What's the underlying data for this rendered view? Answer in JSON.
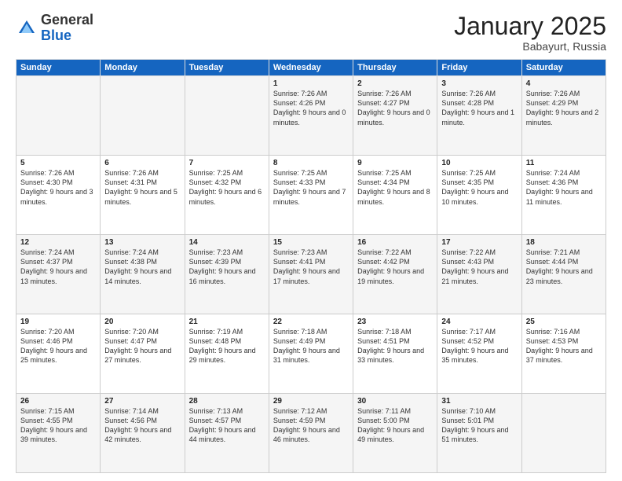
{
  "header": {
    "logo_general": "General",
    "logo_blue": "Blue",
    "title": "January 2025",
    "subtitle": "Babayurt, Russia"
  },
  "weekdays": [
    "Sunday",
    "Monday",
    "Tuesday",
    "Wednesday",
    "Thursday",
    "Friday",
    "Saturday"
  ],
  "weeks": [
    [
      {
        "day": "",
        "sunrise": "",
        "sunset": "",
        "daylight": ""
      },
      {
        "day": "",
        "sunrise": "",
        "sunset": "",
        "daylight": ""
      },
      {
        "day": "",
        "sunrise": "",
        "sunset": "",
        "daylight": ""
      },
      {
        "day": "1",
        "sunrise": "Sunrise: 7:26 AM",
        "sunset": "Sunset: 4:26 PM",
        "daylight": "Daylight: 9 hours and 0 minutes."
      },
      {
        "day": "2",
        "sunrise": "Sunrise: 7:26 AM",
        "sunset": "Sunset: 4:27 PM",
        "daylight": "Daylight: 9 hours and 0 minutes."
      },
      {
        "day": "3",
        "sunrise": "Sunrise: 7:26 AM",
        "sunset": "Sunset: 4:28 PM",
        "daylight": "Daylight: 9 hours and 1 minute."
      },
      {
        "day": "4",
        "sunrise": "Sunrise: 7:26 AM",
        "sunset": "Sunset: 4:29 PM",
        "daylight": "Daylight: 9 hours and 2 minutes."
      }
    ],
    [
      {
        "day": "5",
        "sunrise": "Sunrise: 7:26 AM",
        "sunset": "Sunset: 4:30 PM",
        "daylight": "Daylight: 9 hours and 3 minutes."
      },
      {
        "day": "6",
        "sunrise": "Sunrise: 7:26 AM",
        "sunset": "Sunset: 4:31 PM",
        "daylight": "Daylight: 9 hours and 5 minutes."
      },
      {
        "day": "7",
        "sunrise": "Sunrise: 7:25 AM",
        "sunset": "Sunset: 4:32 PM",
        "daylight": "Daylight: 9 hours and 6 minutes."
      },
      {
        "day": "8",
        "sunrise": "Sunrise: 7:25 AM",
        "sunset": "Sunset: 4:33 PM",
        "daylight": "Daylight: 9 hours and 7 minutes."
      },
      {
        "day": "9",
        "sunrise": "Sunrise: 7:25 AM",
        "sunset": "Sunset: 4:34 PM",
        "daylight": "Daylight: 9 hours and 8 minutes."
      },
      {
        "day": "10",
        "sunrise": "Sunrise: 7:25 AM",
        "sunset": "Sunset: 4:35 PM",
        "daylight": "Daylight: 9 hours and 10 minutes."
      },
      {
        "day": "11",
        "sunrise": "Sunrise: 7:24 AM",
        "sunset": "Sunset: 4:36 PM",
        "daylight": "Daylight: 9 hours and 11 minutes."
      }
    ],
    [
      {
        "day": "12",
        "sunrise": "Sunrise: 7:24 AM",
        "sunset": "Sunset: 4:37 PM",
        "daylight": "Daylight: 9 hours and 13 minutes."
      },
      {
        "day": "13",
        "sunrise": "Sunrise: 7:24 AM",
        "sunset": "Sunset: 4:38 PM",
        "daylight": "Daylight: 9 hours and 14 minutes."
      },
      {
        "day": "14",
        "sunrise": "Sunrise: 7:23 AM",
        "sunset": "Sunset: 4:39 PM",
        "daylight": "Daylight: 9 hours and 16 minutes."
      },
      {
        "day": "15",
        "sunrise": "Sunrise: 7:23 AM",
        "sunset": "Sunset: 4:41 PM",
        "daylight": "Daylight: 9 hours and 17 minutes."
      },
      {
        "day": "16",
        "sunrise": "Sunrise: 7:22 AM",
        "sunset": "Sunset: 4:42 PM",
        "daylight": "Daylight: 9 hours and 19 minutes."
      },
      {
        "day": "17",
        "sunrise": "Sunrise: 7:22 AM",
        "sunset": "Sunset: 4:43 PM",
        "daylight": "Daylight: 9 hours and 21 minutes."
      },
      {
        "day": "18",
        "sunrise": "Sunrise: 7:21 AM",
        "sunset": "Sunset: 4:44 PM",
        "daylight": "Daylight: 9 hours and 23 minutes."
      }
    ],
    [
      {
        "day": "19",
        "sunrise": "Sunrise: 7:20 AM",
        "sunset": "Sunset: 4:46 PM",
        "daylight": "Daylight: 9 hours and 25 minutes."
      },
      {
        "day": "20",
        "sunrise": "Sunrise: 7:20 AM",
        "sunset": "Sunset: 4:47 PM",
        "daylight": "Daylight: 9 hours and 27 minutes."
      },
      {
        "day": "21",
        "sunrise": "Sunrise: 7:19 AM",
        "sunset": "Sunset: 4:48 PM",
        "daylight": "Daylight: 9 hours and 29 minutes."
      },
      {
        "day": "22",
        "sunrise": "Sunrise: 7:18 AM",
        "sunset": "Sunset: 4:49 PM",
        "daylight": "Daylight: 9 hours and 31 minutes."
      },
      {
        "day": "23",
        "sunrise": "Sunrise: 7:18 AM",
        "sunset": "Sunset: 4:51 PM",
        "daylight": "Daylight: 9 hours and 33 minutes."
      },
      {
        "day": "24",
        "sunrise": "Sunrise: 7:17 AM",
        "sunset": "Sunset: 4:52 PM",
        "daylight": "Daylight: 9 hours and 35 minutes."
      },
      {
        "day": "25",
        "sunrise": "Sunrise: 7:16 AM",
        "sunset": "Sunset: 4:53 PM",
        "daylight": "Daylight: 9 hours and 37 minutes."
      }
    ],
    [
      {
        "day": "26",
        "sunrise": "Sunrise: 7:15 AM",
        "sunset": "Sunset: 4:55 PM",
        "daylight": "Daylight: 9 hours and 39 minutes."
      },
      {
        "day": "27",
        "sunrise": "Sunrise: 7:14 AM",
        "sunset": "Sunset: 4:56 PM",
        "daylight": "Daylight: 9 hours and 42 minutes."
      },
      {
        "day": "28",
        "sunrise": "Sunrise: 7:13 AM",
        "sunset": "Sunset: 4:57 PM",
        "daylight": "Daylight: 9 hours and 44 minutes."
      },
      {
        "day": "29",
        "sunrise": "Sunrise: 7:12 AM",
        "sunset": "Sunset: 4:59 PM",
        "daylight": "Daylight: 9 hours and 46 minutes."
      },
      {
        "day": "30",
        "sunrise": "Sunrise: 7:11 AM",
        "sunset": "Sunset: 5:00 PM",
        "daylight": "Daylight: 9 hours and 49 minutes."
      },
      {
        "day": "31",
        "sunrise": "Sunrise: 7:10 AM",
        "sunset": "Sunset: 5:01 PM",
        "daylight": "Daylight: 9 hours and 51 minutes."
      },
      {
        "day": "",
        "sunrise": "",
        "sunset": "",
        "daylight": ""
      }
    ]
  ]
}
